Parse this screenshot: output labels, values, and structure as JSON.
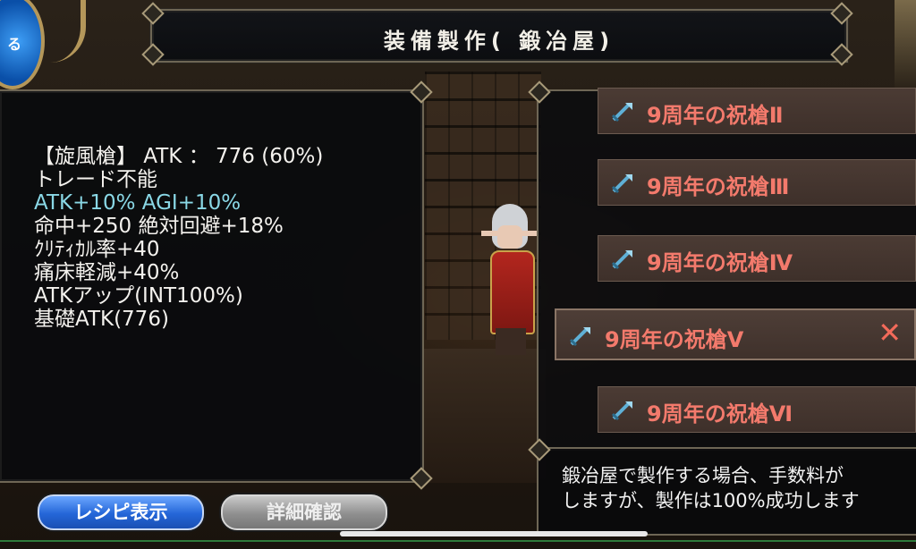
{
  "title": "装備製作( 鍛冶屋)",
  "top_left_button": {
    "label": "る"
  },
  "item_info": {
    "lines": [
      {
        "text": "【旋風槍】 ATK ： 776 (60%)",
        "kind": "normal"
      },
      {
        "text": "トレード不能",
        "kind": "normal"
      },
      {
        "text": "ATK+10% AGI+10%",
        "kind": "bonus"
      },
      {
        "text": "命中+250 絶対回避+18%",
        "kind": "normal"
      },
      {
        "text": "ｸﾘﾃｨｶﾙ率+40",
        "kind": "normal"
      },
      {
        "text": "痛床軽減+40%",
        "kind": "normal"
      },
      {
        "text": "ATKアップ(INT100%)",
        "kind": "normal"
      },
      {
        "text": "基礎ATK(776)",
        "kind": "normal"
      }
    ]
  },
  "buttons": {
    "recipe": "レシピ表示",
    "detail": "詳細確認"
  },
  "recipe_list": {
    "items": [
      {
        "name": "9周年の祝槍Ⅱ",
        "selected": false
      },
      {
        "name": "9周年の祝槍Ⅲ",
        "selected": false
      },
      {
        "name": "9周年の祝槍Ⅳ",
        "selected": false
      },
      {
        "name": "9周年の祝槍Ⅴ",
        "selected": true
      },
      {
        "name": "9周年の祝槍Ⅵ",
        "selected": false
      }
    ],
    "close_glyph": "✕"
  },
  "message": {
    "line1": "鍛冶屋で製作する場合、手数料が",
    "line2": "しますが、製作は100%成功します"
  },
  "colors": {
    "item_name": "#f37a6c",
    "bonus_text": "#8ad8e6",
    "recipe_button": "#2466d8"
  }
}
